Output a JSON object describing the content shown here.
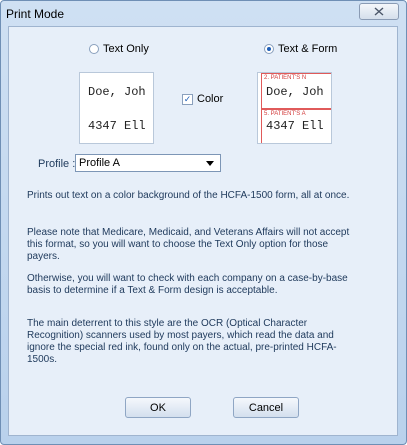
{
  "window": {
    "title": "Print Mode",
    "close_icon": "x-icon"
  },
  "options": {
    "text_only": {
      "label": "Text Only",
      "selected": false
    },
    "text_and_form": {
      "label": "Text & Form",
      "selected": true
    }
  },
  "preview_left": {
    "line1": "Doe, Joh",
    "line2": "4347 Ell"
  },
  "preview_right": {
    "field2_label": "2. PATIENT'S N",
    "line1": "Doe, Joh",
    "field5_label": "5. PATIENT'S A",
    "line2": "4347 Ell"
  },
  "color_checkbox": {
    "label": "Color",
    "checked": true
  },
  "profile": {
    "label": "Profile :",
    "selected": "Profile A"
  },
  "description": [
    "Prints out text on a color background of the HCFA-1500 form, all at once.",
    "Please note that Medicare, Medicaid, and Veterans Affairs will not accept this format, so you will want to choose the Text Only option for those payers.",
    "Otherwise, you will want to check with each company on a case-by-base basis to determine if a Text & Form design is acceptable.",
    "The main deterrent to this style are the OCR (Optical Character Recognition) scanners used by most payers, which read the data and ignore the special red ink, found only on the actual, pre-printed HCFA-1500s."
  ],
  "buttons": {
    "ok": "OK",
    "cancel": "Cancel"
  }
}
